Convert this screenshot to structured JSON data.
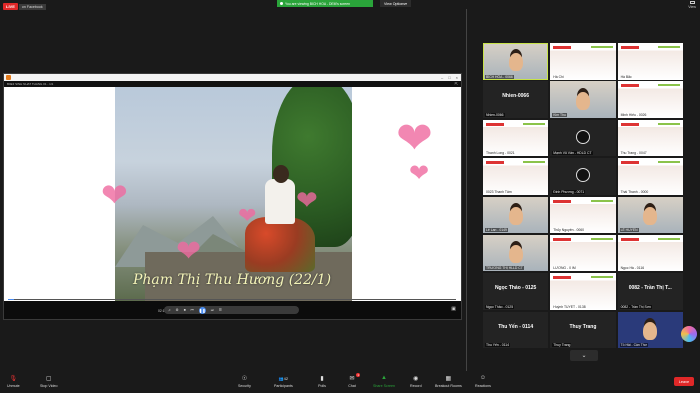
{
  "topbar": {
    "live_label": "LIVE",
    "live_destination": "on Facebook",
    "share_banner": "You are viewing BICH HOA - DEM's screen",
    "view_options": "View Options",
    "view_label": "View"
  },
  "shared_video": {
    "title": "B0E3 SINH NHAT THANG 01 - 1/1",
    "overlay_name": "Phạm Thị Thu Hương (22/1)",
    "elapsed": "02:10",
    "progress_fraction": 0.013
  },
  "gallery": {
    "tiles": [
      {
        "label": "BÍCH HÒA - 0066",
        "kind": "video",
        "active": true
      },
      {
        "label": "Hà Chi",
        "kind": "slide"
      },
      {
        "label": "Hà Bắc",
        "kind": "slide"
      },
      {
        "label": "Nhien-0066",
        "kind": "name",
        "name": "Nhien-0066"
      },
      {
        "label": "Kim Thu",
        "kind": "video"
      },
      {
        "label": "Minh Hiếu - 0026",
        "kind": "slide"
      },
      {
        "label": "Thanh Long - 0021",
        "kind": "slide"
      },
      {
        "label": "Mạnh Vũ Vân - HDLD CT",
        "kind": "logo"
      },
      {
        "label": "Thu Trang - 0047",
        "kind": "slide"
      },
      {
        "label": "0023 Thanh Tâm",
        "kind": "slide"
      },
      {
        "label": "Đinh Phương - 0071",
        "kind": "logo"
      },
      {
        "label": "Thái Thanh - 0000",
        "kind": "slide"
      },
      {
        "label": "Lê Lan - 0149",
        "kind": "video"
      },
      {
        "label": "Thủy Nguyên - 0060",
        "kind": "slide"
      },
      {
        "label": "LÊ HUYỀN",
        "kind": "video"
      },
      {
        "label": "TRƯƠNG THỊ HLLD CT",
        "kind": "video"
      },
      {
        "label": "LƯƠNG - 0 IM",
        "kind": "slide"
      },
      {
        "label": "Ngọc Hà - 0116",
        "kind": "slide"
      },
      {
        "label": "Ngọc Thảo - 0125",
        "kind": "name",
        "name": "Ngọc Thảo - 0125"
      },
      {
        "label": "Huỳnh TUYẾT - 0138",
        "kind": "slide"
      },
      {
        "label": "0082 - Trần Thị Sơn",
        "kind": "name",
        "name": "0082 - Trần Thị T..."
      },
      {
        "label": "Thu Yến - 0114",
        "kind": "name",
        "name": "Thu Yến - 0114"
      },
      {
        "label": "Thuy Trang",
        "kind": "name",
        "name": "Thuy Trang"
      },
      {
        "label": "Tô Hải - Cần Thơ",
        "kind": "bluebg"
      }
    ]
  },
  "toolbar": {
    "unmute": "Unmute",
    "stop_video": "Stop Video",
    "security": "Security",
    "participants": "Participants",
    "participants_count": "42",
    "polls": "Polls",
    "chat": "Chat",
    "chat_badge": "1",
    "share_screen": "Share Screen",
    "record": "Record",
    "breakout_rooms": "Breakout Rooms",
    "reactions": "Reactions",
    "leave": "Leave"
  },
  "colors": {
    "live_red": "#e02828",
    "share_green": "#2aa43a",
    "active_speaker": "#c8e34a",
    "accent_blue": "#4a8cf0"
  }
}
